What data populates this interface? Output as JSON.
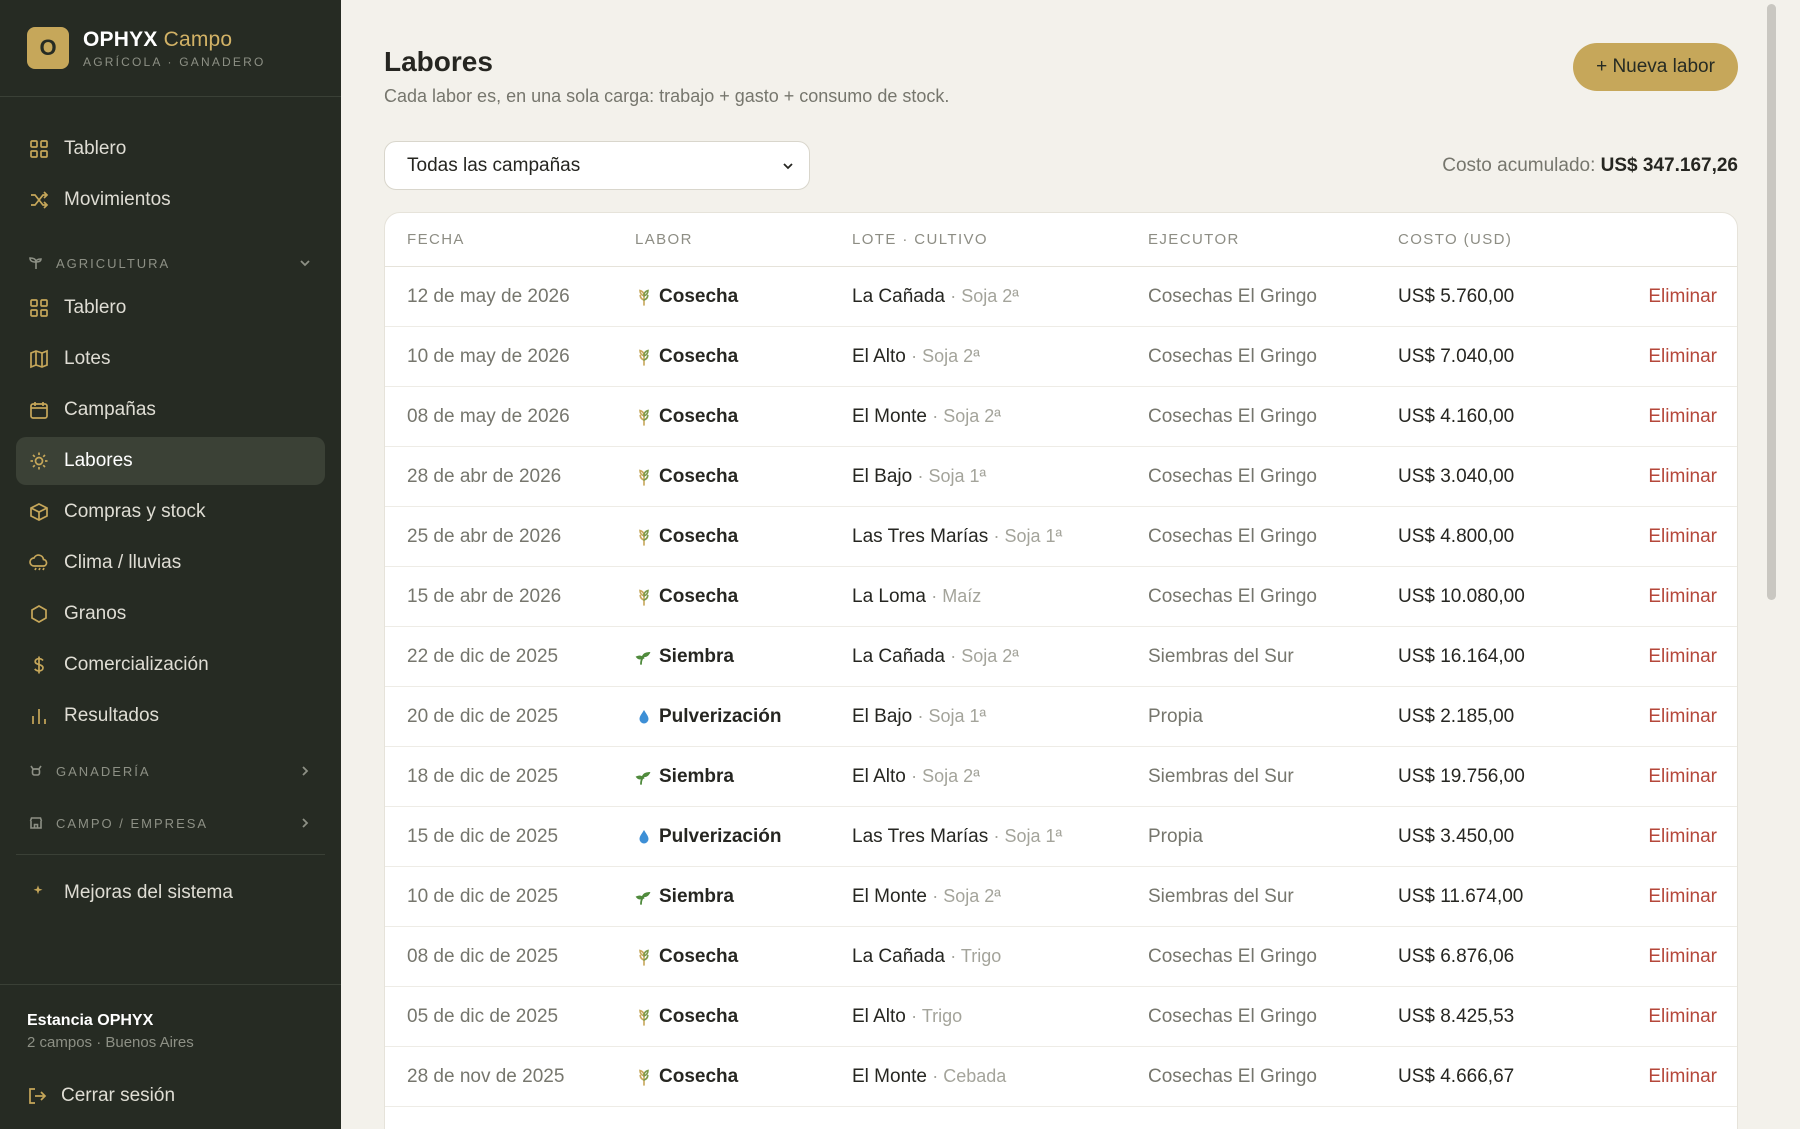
{
  "brand": {
    "logo_letter": "O",
    "name": "OPHYX",
    "name_accent": "Campo",
    "subtitle": "AGRÍCOLA · GANADERO"
  },
  "nav_top": [
    {
      "label": "Tablero",
      "icon": "grid-icon"
    },
    {
      "label": "Movimientos",
      "icon": "shuffle-icon"
    }
  ],
  "section_agricultura": {
    "label": "AGRICULTURA",
    "icon": "sprout-icon",
    "expanded": true
  },
  "nav_agri": [
    {
      "label": "Tablero",
      "icon": "grid-icon"
    },
    {
      "label": "Lotes",
      "icon": "map-icon"
    },
    {
      "label": "Campañas",
      "icon": "calendar-icon"
    },
    {
      "label": "Labores",
      "icon": "sun-icon",
      "active": true
    },
    {
      "label": "Compras y stock",
      "icon": "box-icon"
    },
    {
      "label": "Clima / lluvias",
      "icon": "cloud-rain-icon"
    },
    {
      "label": "Granos",
      "icon": "hexagon-icon"
    },
    {
      "label": "Comercialización",
      "icon": "dollar-icon"
    },
    {
      "label": "Resultados",
      "icon": "bar-chart-icon"
    }
  ],
  "section_ganaderia": {
    "label": "GANADERÍA",
    "icon": "cow-icon"
  },
  "section_campo": {
    "label": "CAMPO / EMPRESA",
    "icon": "store-icon"
  },
  "nav_extra": {
    "label": "Mejoras del sistema",
    "icon": "sparkle-icon"
  },
  "footer": {
    "estancia": "Estancia OPHYX",
    "estancia_sub": "2 campos · Buenos Aires",
    "logout": "Cerrar sesión"
  },
  "header": {
    "title": "Labores",
    "subtitle": "Cada labor es, en una sola carga: trabajo + gasto + consumo de stock.",
    "new_button": "+ Nueva labor"
  },
  "filter": {
    "campaign_selected": "Todas las campañas"
  },
  "accum": {
    "label": "Costo acumulado:",
    "value": "US$ 347.167,26"
  },
  "table": {
    "columns": [
      "FECHA",
      "LABOR",
      "LOTE · CULTIVO",
      "EJECUTOR",
      "COSTO (USD)"
    ],
    "action_label": "Eliminar",
    "rows": [
      {
        "fecha": "12 de may de 2026",
        "labor": "Cosecha",
        "tipo": "cosecha",
        "lote": "La Cañada",
        "cultivo": "· Soja 2ª",
        "ejecutor": "Cosechas El Gringo",
        "costo": "US$ 5.760,00"
      },
      {
        "fecha": "10 de may de 2026",
        "labor": "Cosecha",
        "tipo": "cosecha",
        "lote": "El Alto",
        "cultivo": "· Soja 2ª",
        "ejecutor": "Cosechas El Gringo",
        "costo": "US$ 7.040,00"
      },
      {
        "fecha": "08 de may de 2026",
        "labor": "Cosecha",
        "tipo": "cosecha",
        "lote": "El Monte",
        "cultivo": "· Soja 2ª",
        "ejecutor": "Cosechas El Gringo",
        "costo": "US$ 4.160,00"
      },
      {
        "fecha": "28 de abr de 2026",
        "labor": "Cosecha",
        "tipo": "cosecha",
        "lote": "El Bajo",
        "cultivo": "· Soja 1ª",
        "ejecutor": "Cosechas El Gringo",
        "costo": "US$ 3.040,00"
      },
      {
        "fecha": "25 de abr de 2026",
        "labor": "Cosecha",
        "tipo": "cosecha",
        "lote": "Las Tres Marías",
        "cultivo": "· Soja 1ª",
        "ejecutor": "Cosechas El Gringo",
        "costo": "US$ 4.800,00"
      },
      {
        "fecha": "15 de abr de 2026",
        "labor": "Cosecha",
        "tipo": "cosecha",
        "lote": "La Loma",
        "cultivo": "· Maíz",
        "ejecutor": "Cosechas El Gringo",
        "costo": "US$ 10.080,00"
      },
      {
        "fecha": "22 de dic de 2025",
        "labor": "Siembra",
        "tipo": "siembra",
        "lote": "La Cañada",
        "cultivo": "· Soja 2ª",
        "ejecutor": "Siembras del Sur",
        "costo": "US$ 16.164,00"
      },
      {
        "fecha": "20 de dic de 2025",
        "labor": "Pulverización",
        "tipo": "pulverizacion",
        "lote": "El Bajo",
        "cultivo": "· Soja 1ª",
        "ejecutor": "Propia",
        "costo": "US$ 2.185,00"
      },
      {
        "fecha": "18 de dic de 2025",
        "labor": "Siembra",
        "tipo": "siembra",
        "lote": "El Alto",
        "cultivo": "· Soja 2ª",
        "ejecutor": "Siembras del Sur",
        "costo": "US$ 19.756,00"
      },
      {
        "fecha": "15 de dic de 2025",
        "labor": "Pulverización",
        "tipo": "pulverizacion",
        "lote": "Las Tres Marías",
        "cultivo": "· Soja 1ª",
        "ejecutor": "Propia",
        "costo": "US$ 3.450,00"
      },
      {
        "fecha": "10 de dic de 2025",
        "labor": "Siembra",
        "tipo": "siembra",
        "lote": "El Monte",
        "cultivo": "· Soja 2ª",
        "ejecutor": "Siembras del Sur",
        "costo": "US$ 11.674,00"
      },
      {
        "fecha": "08 de dic de 2025",
        "labor": "Cosecha",
        "tipo": "cosecha",
        "lote": "La Cañada",
        "cultivo": "· Trigo",
        "ejecutor": "Cosechas El Gringo",
        "costo": "US$ 6.876,06"
      },
      {
        "fecha": "05 de dic de 2025",
        "labor": "Cosecha",
        "tipo": "cosecha",
        "lote": "El Alto",
        "cultivo": "· Trigo",
        "ejecutor": "Cosechas El Gringo",
        "costo": "US$ 8.425,53"
      },
      {
        "fecha": "28 de nov de 2025",
        "labor": "Cosecha",
        "tipo": "cosecha",
        "lote": "El Monte",
        "cultivo": "· Cebada",
        "ejecutor": "Cosechas El Gringo",
        "costo": "US$ 4.666,67"
      }
    ]
  },
  "colors": {
    "sidebar_bg": "#262b23",
    "accent": "#c6a75a",
    "danger": "#b5473a",
    "page_bg": "#f3f1eb"
  }
}
